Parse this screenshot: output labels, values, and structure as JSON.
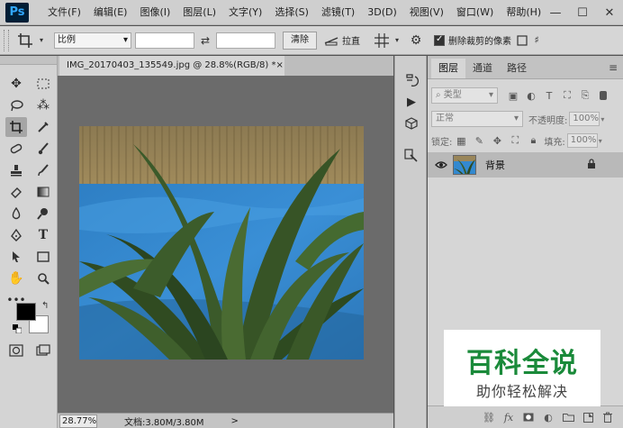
{
  "app": {
    "logo": "Ps"
  },
  "menu": [
    "文件(F)",
    "编辑(E)",
    "图像(I)",
    "图层(L)",
    "文字(Y)",
    "选择(S)",
    "滤镜(T)",
    "3D(D)",
    "视图(V)",
    "窗口(W)",
    "帮助(H)"
  ],
  "window_controls": {
    "minimize": "—",
    "maximize": "☐",
    "close": "✕"
  },
  "options": {
    "ratio_select": "比例",
    "clear_button": "清除",
    "straighten_label": "拉直",
    "delete_cropped_label": "删除裁剪的像素",
    "delete_cropped_checked": true
  },
  "document": {
    "tab_title": "IMG_20170403_135549.jpg @ 28.8%(RGB/8) *",
    "tab_close": "×",
    "zoom": "28.77%",
    "doc_info": "文档:3.80M/3.80M",
    "status_arrow": ">"
  },
  "layers_panel": {
    "tabs": [
      "图层",
      "通道",
      "路径"
    ],
    "active_tab": 0,
    "menu_icon": "≡",
    "filter_kind": "类型",
    "blend_mode": "正常",
    "opacity_label": "不透明度:",
    "opacity_value": "100%",
    "lock_label": "锁定:",
    "fill_label": "填充:",
    "fill_value": "100%",
    "layers": [
      {
        "name": "背景",
        "visible": true,
        "locked": true
      }
    ]
  },
  "watermark": {
    "title": "百科全说",
    "subtitle": "助你轻松解决"
  },
  "colors": {
    "foreground": "#000000",
    "background": "#ffffff",
    "watermark_green": "#1a8a3a"
  }
}
